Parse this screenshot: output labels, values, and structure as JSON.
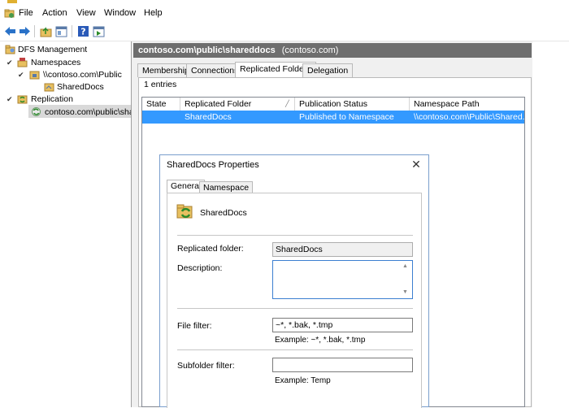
{
  "menu": [
    "File",
    "Action",
    "View",
    "Window",
    "Help"
  ],
  "tree": {
    "root": "DFS Management",
    "namespaces": "Namespaces",
    "namespace_path": "\\\\contoso.com\\Public",
    "shared_docs": "SharedDocs",
    "replication": "Replication",
    "replication_group": "contoso.com\\public\\shareddocs"
  },
  "details": {
    "title": "contoso.com\\public\\shareddocs",
    "subtitle": "(contoso.com)",
    "tabs": [
      "Memberships",
      "Connections",
      "Replicated Folders",
      "Delegation"
    ],
    "active_tab": "Replicated Folders",
    "entries": "1 entries",
    "columns": [
      "State",
      "Replicated Folder",
      "Publication Status",
      "Namespace Path"
    ],
    "rows": [
      {
        "state": "",
        "folder": "SharedDocs",
        "status": "Published to Namespace",
        "path": "\\\\contoso.com\\Public\\Shared..."
      }
    ]
  },
  "dialog": {
    "title": "SharedDocs Properties",
    "tabs": [
      "General",
      "Namespace"
    ],
    "folder_name": "SharedDocs",
    "replicated_folder_label": "Replicated folder:",
    "replicated_folder_value": "SharedDocs",
    "description_label": "Description:",
    "description_value": "",
    "file_filter_label": "File filter:",
    "file_filter_value": "~*, *.bak, *.tmp",
    "file_filter_example": "Example: ~*, *.bak, *.tmp",
    "subfolder_filter_label": "Subfolder filter:",
    "subfolder_filter_value": "",
    "subfolder_filter_example": "Example: Temp",
    "close_glyph": "✕"
  },
  "colors": {
    "selection": "#3399ff",
    "title_bar": "#6e6e6e",
    "dialog_border": "#7a9ecd"
  }
}
